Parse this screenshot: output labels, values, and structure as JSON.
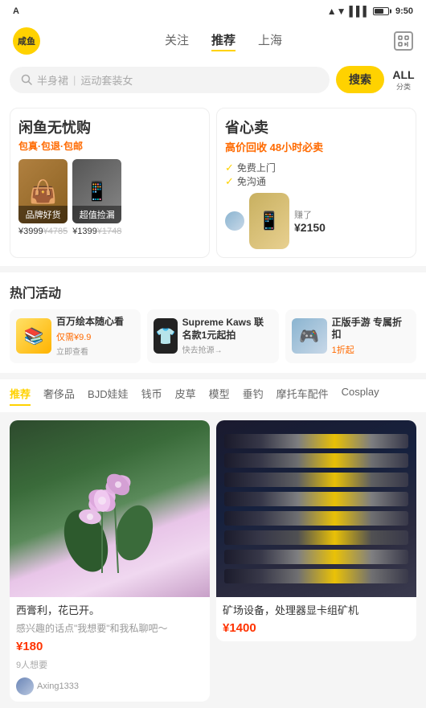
{
  "statusBar": {
    "carrier": "A",
    "time": "9:50",
    "wifi": "▲▼",
    "battery": "70"
  },
  "header": {
    "logoText": "咸鱼",
    "tabs": [
      {
        "label": "关注",
        "active": false
      },
      {
        "label": "推荐",
        "active": true
      },
      {
        "label": "上海",
        "active": false
      }
    ],
    "scanLabel": "扫"
  },
  "search": {
    "placeholder1": "半身裙",
    "placeholder2": "运动套装女",
    "searchBtn": "搜索",
    "allBtn": "ALL",
    "allSub": "分类"
  },
  "bannerLeft": {
    "title": "闲鱼无忧购",
    "subtitle": "包真·包退·包邮",
    "products": [
      {
        "label": "品牌好货",
        "price": "¥3999",
        "oldPrice": "¥4785"
      },
      {
        "label": "超值捡漏",
        "price": "¥1399",
        "oldPrice": "¥1748"
      }
    ]
  },
  "bannerRight": {
    "title": "省心卖",
    "subtitle": "高价回收 48小时必卖",
    "checks": [
      "免费上门",
      "免沟通"
    ],
    "soldNote": "赚了¥2150"
  },
  "hotActivities": {
    "title": "热门活动",
    "items": [
      {
        "title": "百万绘本随心看",
        "desc": "仅需¥9.9",
        "link": "立即查看",
        "type": "book"
      },
      {
        "title": "Supreme Kaws 联名款1元起拍",
        "desc": "",
        "link": "快去抢源→",
        "type": "tshirt"
      },
      {
        "title": "正版手游 专属折扣",
        "desc": "1折起",
        "link": "",
        "type": "model"
      }
    ]
  },
  "categories": {
    "items": [
      {
        "label": "推荐",
        "active": true
      },
      {
        "label": "奢侈品",
        "active": false
      },
      {
        "label": "BJD娃娃",
        "active": false
      },
      {
        "label": "钱币",
        "active": false
      },
      {
        "label": "皮草",
        "active": false
      },
      {
        "label": "模型",
        "active": false
      },
      {
        "label": "垂钓",
        "active": false
      },
      {
        "label": "摩托车配件",
        "active": false
      },
      {
        "label": "Cosplay",
        "active": false
      }
    ]
  },
  "products": [
    {
      "id": 1,
      "title": "西膏利，花已开。",
      "subtitle": "感兴趣的话点\"我想要\"和我私聊吧～",
      "price": "¥180",
      "likes": "9人想要",
      "seller": "Axing1333",
      "type": "flower"
    },
    {
      "id": 2,
      "title": "矿场设备，处理器显卡组矿机",
      "subtitle": "",
      "price": "¥1400",
      "likes": "",
      "seller": "",
      "type": "gpu"
    }
  ]
}
